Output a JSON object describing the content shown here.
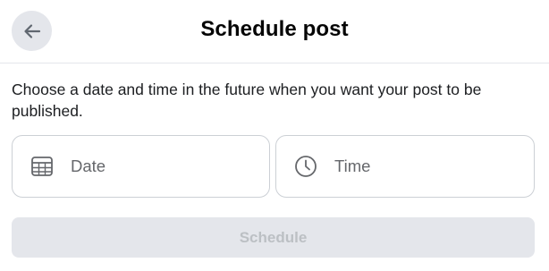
{
  "header": {
    "title": "Schedule post",
    "back_icon": "arrow-left-icon"
  },
  "description": "Choose a date and time in the future when you want your post to be published.",
  "fields": {
    "date": {
      "placeholder": "Date",
      "icon": "calendar-icon"
    },
    "time": {
      "placeholder": "Time",
      "icon": "clock-icon"
    }
  },
  "actions": {
    "schedule_label": "Schedule",
    "schedule_enabled": false
  },
  "colors": {
    "icon": "#65676b",
    "border": "#ccd0d5",
    "disabled_bg": "#e4e6eb",
    "disabled_text": "#bcc0c4"
  }
}
